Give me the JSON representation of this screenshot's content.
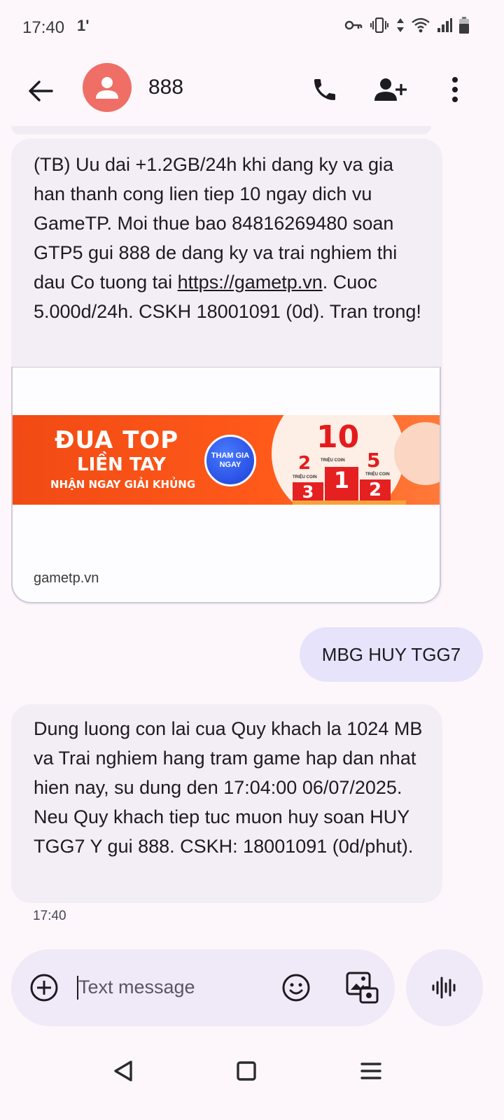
{
  "status_bar": {
    "time": "17:40",
    "indicator": "1'",
    "icons": [
      "key-icon",
      "vibrate-icon",
      "data-arrows-icon",
      "wifi-icon",
      "signal-icon",
      "battery-icon"
    ]
  },
  "header": {
    "contact_name": "888",
    "avatar_color": "#ef6f66",
    "icons": [
      "back-arrow-icon",
      "person-icon",
      "phone-icon",
      "add-person-icon",
      "more-vert-icon"
    ]
  },
  "messages": [
    {
      "direction": "incoming",
      "text_before_link": "(TB) Uu dai +1.2GB/24h khi dang ky va gia han thanh cong lien tiep 10 ngay dich vu GameTP. Moi thue bao 84816269480 soan GTP5 gui 888 de dang ky va trai nghiem thi dau Co tuong tai ",
      "link": "https://gametp.vn",
      "text_after_link": ". Cuoc 5.000d/24h. CSKH 18001091 (0d). Tran trong!",
      "preview": {
        "banner_title_1": "ĐUA TOP",
        "banner_title_2": "LIỀN TAY",
        "banner_subtitle": "NHẬN NGAY GIẢI KHỦNG",
        "banner_cta": "THAM GIA NGAY",
        "podium": {
          "first_prize": "10",
          "second_prize": "2",
          "third_prize": "5",
          "prize_unit": "TRIỆU COIN",
          "rank_center": "1",
          "rank_left": "3",
          "rank_right": "2"
        },
        "domain": "gametp.vn"
      }
    },
    {
      "direction": "outgoing",
      "text": "MBG HUY TGG7"
    },
    {
      "direction": "incoming",
      "text": "Dung luong con lai cua Quy khach la 1024 MB va Trai nghiem hang tram game hap dan nhat hien nay, su dung den 17:04:00 06/07/2025. Neu Quy khach tiep tuc muon huy soan HUY TGG7 Y gui 888. CSKH: 18001091 (0d/phut).",
      "timestamp": "17:40"
    }
  ],
  "composer": {
    "placeholder": "Text message",
    "icons": [
      "add-circle-icon",
      "emoji-icon",
      "gallery-icon",
      "voice-waveform-icon"
    ]
  },
  "nav_bar": {
    "icons": [
      "nav-back-icon",
      "nav-home-icon",
      "nav-menu-icon"
    ]
  },
  "colors": {
    "background": "#fdf7fb",
    "incoming_bubble": "#f3edf6",
    "outgoing_bubble": "#e6e3fb",
    "composer": "#f0eaf8",
    "banner": "#f14a14"
  }
}
